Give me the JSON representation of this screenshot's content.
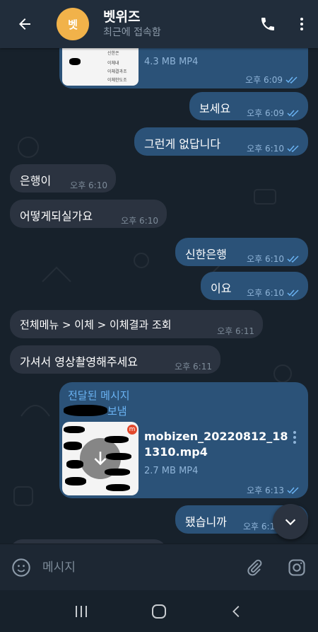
{
  "header": {
    "avatar_text": "벳",
    "title": "벳위즈",
    "status": "최근에 접속함"
  },
  "messages": [
    {
      "dir": "out",
      "kind": "file_partial",
      "size": "4.3 MB MP4",
      "time": "오후 6:09"
    },
    {
      "dir": "out",
      "text": "보세요",
      "time": "오후 6:09"
    },
    {
      "dir": "out",
      "text": "그런게 없답니다",
      "time": "오후 6:10"
    },
    {
      "dir": "in",
      "text": "은행이",
      "time": "오후 6:10"
    },
    {
      "dir": "in",
      "text": "어떻게되실가요",
      "time": "오후 6:10"
    },
    {
      "dir": "out",
      "text": "신한은행",
      "time": "오후 6:10"
    },
    {
      "dir": "out",
      "text": "이요",
      "time": "오후 6:10"
    },
    {
      "dir": "in",
      "text": "전체메뉴 > 이체 > 이체결과 조회",
      "time": "오후 6:11"
    },
    {
      "dir": "in",
      "text": "가셔서 영상촬영해주세요",
      "time": "오후 6:11"
    },
    {
      "dir": "out",
      "kind": "forwarded_file",
      "forward_label": "전달된 메시지",
      "forward_from": "보냄",
      "file_name_line1": "mobizen_20220812_18",
      "file_name_line2": "1310.mp4",
      "size": "2.7 MB MP4",
      "time": "오후 6:13"
    },
    {
      "dir": "out",
      "text": "됐습니까",
      "time": "오후 6:1"
    }
  ],
  "partial_thumb_labels": [
    "신한은",
    "이체내",
    "이체결과조",
    "이체한도조"
  ],
  "input": {
    "placeholder": "메시지"
  },
  "colors": {
    "header_bg": "#212d3b",
    "chat_bg": "#17212b",
    "outgoing_bubble": "#2b5278",
    "incoming_bubble": "#2b3340",
    "accent": "#6ab3f3",
    "avatar": "#f1b24a"
  },
  "icons": {
    "back": "back-arrow-icon",
    "call": "phone-icon",
    "menu": "more-vertical-icon",
    "emoji": "smiley-icon",
    "attach": "paperclip-icon",
    "camera": "instagram-camera-icon",
    "scroll_down": "chevron-down-icon",
    "download": "download-arrow-icon"
  }
}
